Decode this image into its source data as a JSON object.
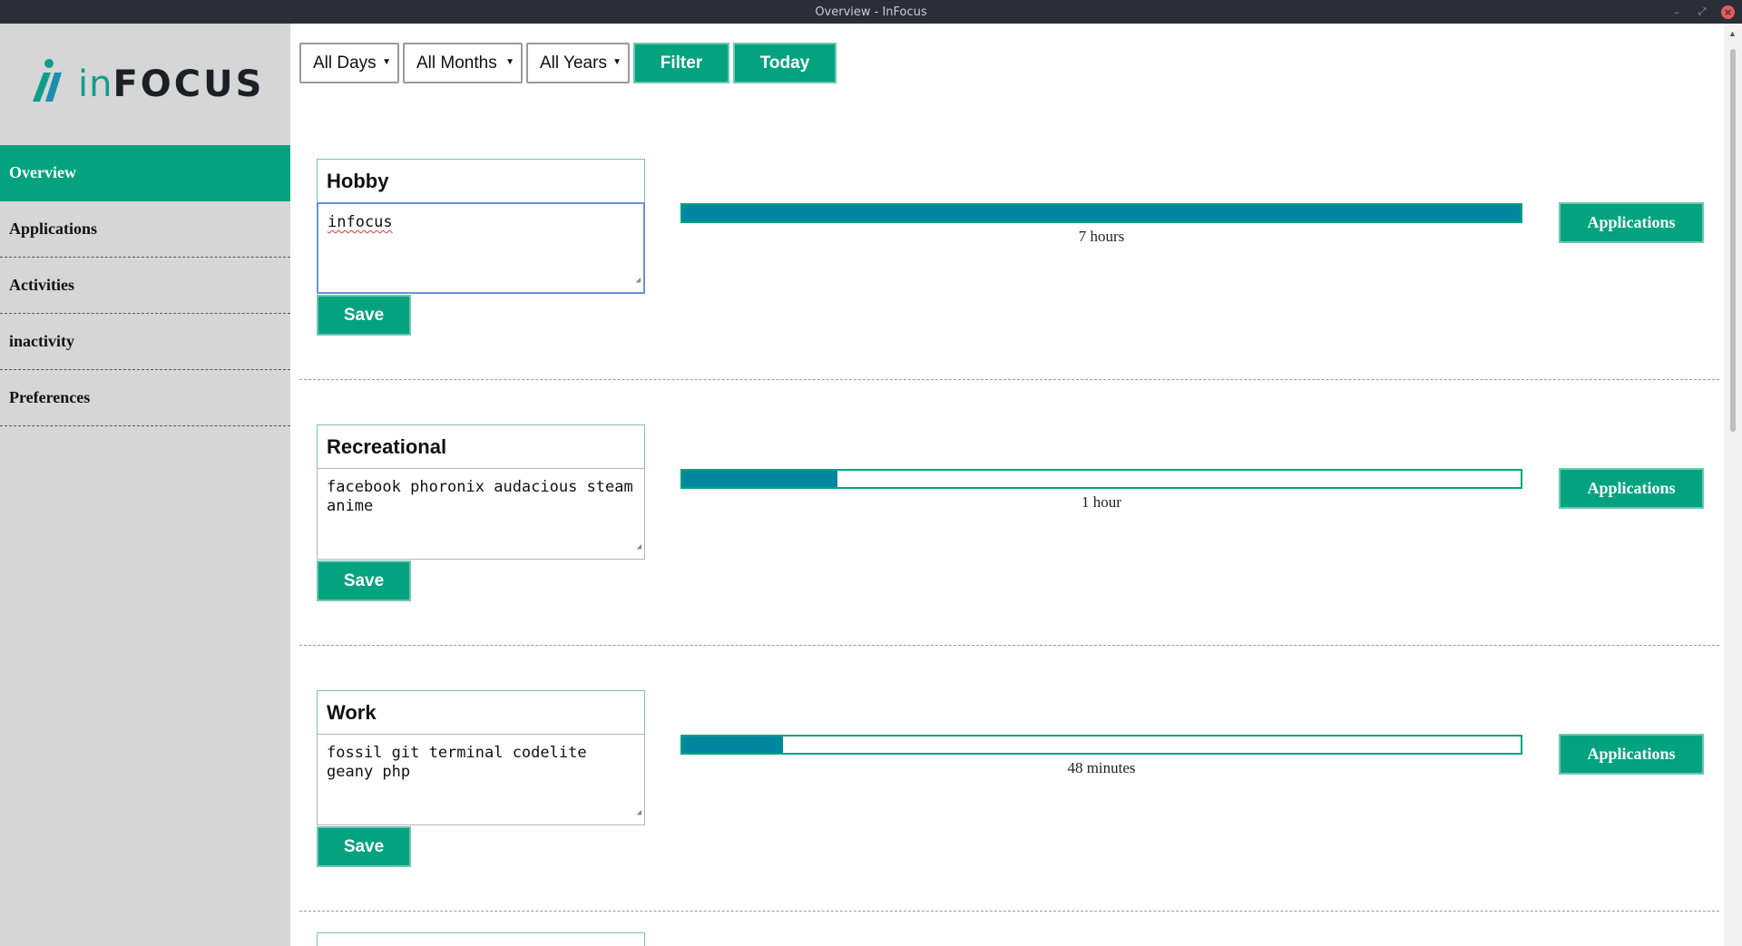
{
  "window": {
    "title": "Overview - InFocus"
  },
  "logo": {
    "text_in": "in",
    "text_focus": "FOCUS"
  },
  "sidebar": {
    "items": [
      {
        "label": "Overview",
        "active": true
      },
      {
        "label": "Applications",
        "active": false
      },
      {
        "label": "Activities",
        "active": false
      },
      {
        "label": "inactivity",
        "active": false
      },
      {
        "label": "Preferences",
        "active": false
      }
    ]
  },
  "toolbar": {
    "day_select": "All Days",
    "month_select": "All Months",
    "year_select": "All Years",
    "filter_label": "Filter",
    "today_label": "Today"
  },
  "categories": [
    {
      "name": "Hobby",
      "keywords": "infocus",
      "duration": "7 hours",
      "progress": 1.0,
      "save_label": "Save",
      "apps_label": "Applications"
    },
    {
      "name": "Recreational",
      "keywords": "facebook phoronix audacious steam anime",
      "duration": "1 hour",
      "progress": 0.185,
      "save_label": "Save",
      "apps_label": "Applications"
    },
    {
      "name": "Work",
      "keywords": "fossil git terminal codelite geany php",
      "duration": "48 minutes",
      "progress": 0.12,
      "save_label": "Save",
      "apps_label": "Applications"
    }
  ],
  "colors": {
    "accent": "#03a37f",
    "bar_fill": "#00879f",
    "sidebar_bg": "#d6d6d6",
    "titlebar_bg": "#2b2e37"
  }
}
